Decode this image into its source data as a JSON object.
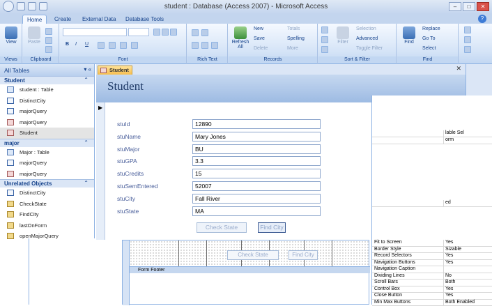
{
  "window": {
    "title": "student : Database (Access 2007) - Microsoft Access",
    "min": "–",
    "max": "□",
    "close": "✕"
  },
  "tabs": [
    "Home",
    "Create",
    "External Data",
    "Database Tools"
  ],
  "help": "?",
  "ribbon": {
    "views": {
      "label": "Views",
      "view": "View"
    },
    "clipboard": {
      "label": "Clipboard",
      "paste": "Paste"
    },
    "font": {
      "label": "Font",
      "bold": "B",
      "italic": "I",
      "underline": "U"
    },
    "richtext": {
      "label": "Rich Text"
    },
    "records": {
      "label": "Records",
      "refresh": "Refresh All",
      "new": "New",
      "save": "Save",
      "delete": "Delete",
      "totals": "Totals",
      "spelling": "Spelling",
      "more": "More"
    },
    "sortfilter": {
      "label": "Sort & Filter",
      "filter": "Filter",
      "selection": "Selection",
      "advanced": "Advanced",
      "toggle": "Toggle Filter"
    },
    "find": {
      "label": "Find",
      "find": "Find",
      "replace": "Replace",
      "goto": "Go To",
      "select": "Select"
    }
  },
  "nav": {
    "header": "All Tables",
    "sections": [
      {
        "title": "Student",
        "items": [
          {
            "label": "student : Table",
            "type": "table"
          },
          {
            "label": "DistinctCity",
            "type": "query"
          },
          {
            "label": "majorQuery",
            "type": "query"
          },
          {
            "label": "majorQuery",
            "type": "form"
          },
          {
            "label": "Student",
            "type": "form"
          }
        ]
      },
      {
        "title": "major",
        "items": [
          {
            "label": "Major : Table",
            "type": "table"
          },
          {
            "label": "majorQuery",
            "type": "query"
          },
          {
            "label": "majorQuery",
            "type": "form"
          }
        ]
      },
      {
        "title": "Unrelated Objects",
        "items": [
          {
            "label": "DistinctCity",
            "type": "query"
          },
          {
            "label": "CheckState",
            "type": "macro"
          },
          {
            "label": "FindCity",
            "type": "macro"
          },
          {
            "label": "lastOnForm",
            "type": "macro"
          },
          {
            "label": "openMajorQuery",
            "type": "macro"
          }
        ]
      }
    ]
  },
  "document": {
    "tab": "Student",
    "close": "✕",
    "title": "Student",
    "fields": [
      {
        "label": "stuId",
        "value": "12890"
      },
      {
        "label": "stuName",
        "value": "Mary Jones"
      },
      {
        "label": "stuMajor",
        "value": "BU"
      },
      {
        "label": "stuGPA",
        "value": "3.3"
      },
      {
        "label": "stuCredits",
        "value": "15"
      },
      {
        "label": "stuSemEntered",
        "value": "52007"
      },
      {
        "label": "stuCity",
        "value": "Fall River"
      },
      {
        "label": "stuState",
        "value": "MA"
      }
    ],
    "check_state": "Check State",
    "find_city": "Find City"
  },
  "design": {
    "check_state": "Check State",
    "find_city": "Find City",
    "form_footer": "Form Footer"
  },
  "property_fragments": [
    "lable Sel",
    "orm",
    "ed"
  ],
  "properties": [
    {
      "k": "Fit to Screen",
      "v": "Yes"
    },
    {
      "k": "Border Style",
      "v": "Sizable"
    },
    {
      "k": "Record Selectors",
      "v": "Yes"
    },
    {
      "k": "Navigation Buttons",
      "v": "Yes"
    },
    {
      "k": "Navigation Caption",
      "v": ""
    },
    {
      "k": "Dividing Lines",
      "v": "No"
    },
    {
      "k": "Scroll Bars",
      "v": "Both"
    },
    {
      "k": "Control Box",
      "v": "Yes"
    },
    {
      "k": "Close Button",
      "v": "Yes"
    },
    {
      "k": "Min Max Buttons",
      "v": "Both Enabled"
    }
  ]
}
